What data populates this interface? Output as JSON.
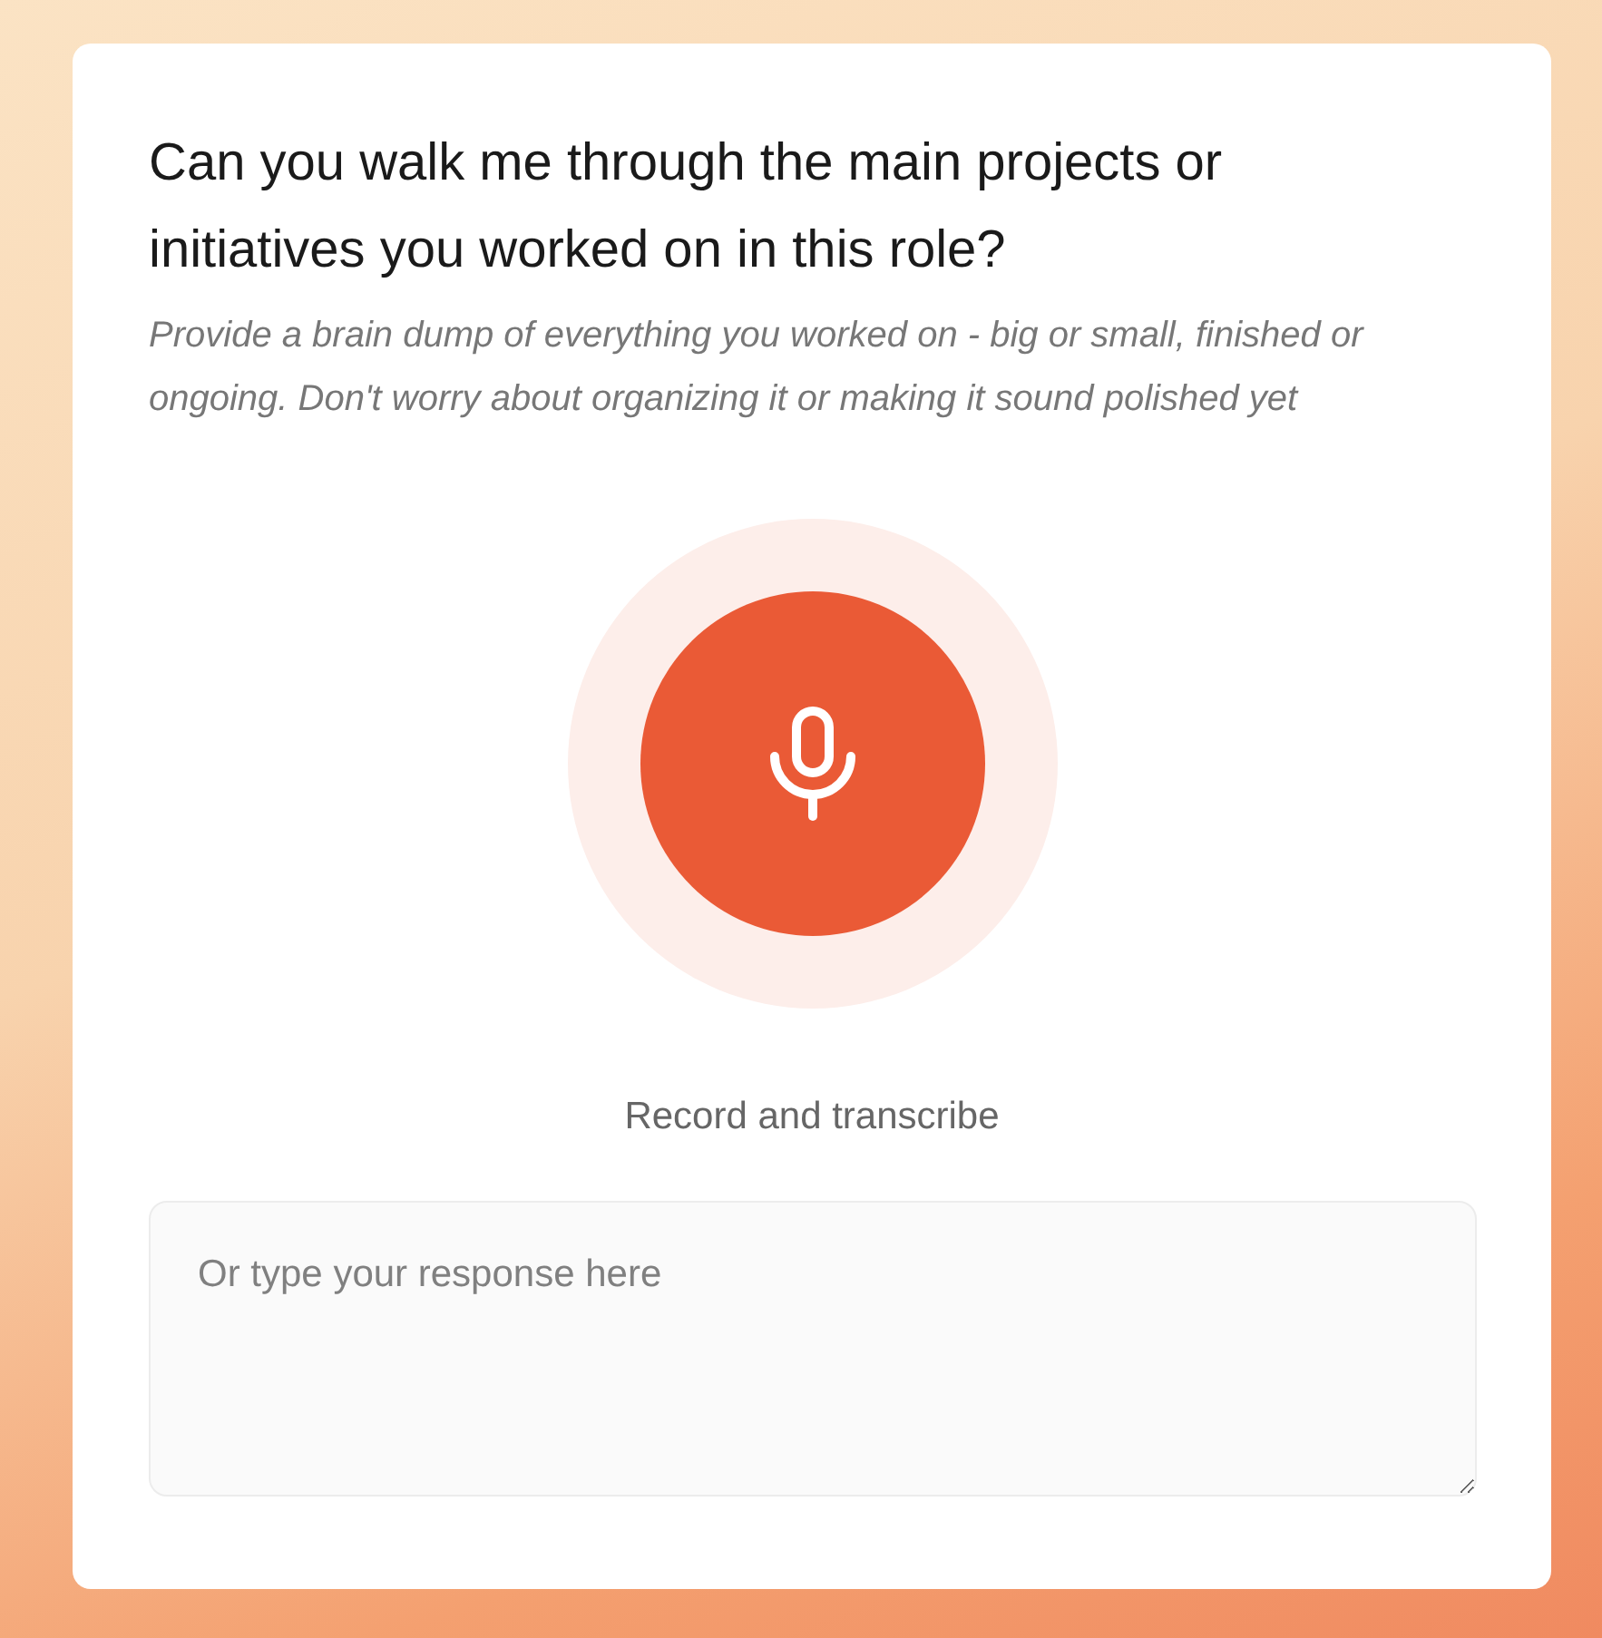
{
  "question": {
    "title": "Can you walk me through the main projects or initiatives you worked on in this role?",
    "hint": "Provide a brain dump of everything you worked on - big or small, finished or ongoing. Don't worry about organizing it or making it sound polished yet"
  },
  "record": {
    "label": "Record and transcribe"
  },
  "response": {
    "placeholder": "Or type your response here"
  }
}
